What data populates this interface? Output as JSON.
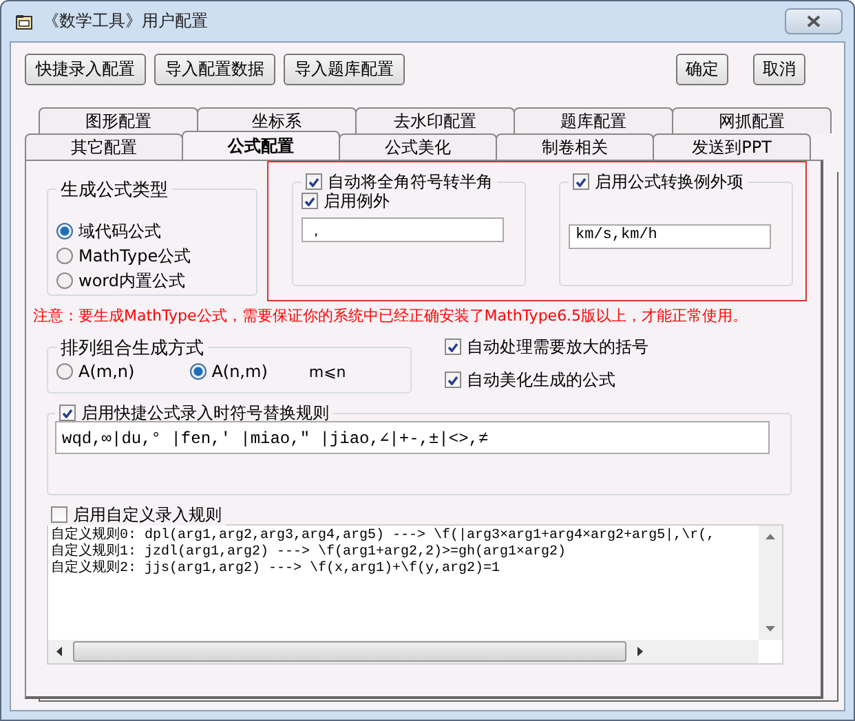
{
  "window": {
    "title": "《数学工具》用户配置"
  },
  "toolbar_buttons": [
    "快捷录入配置",
    "导入配置数据",
    "导入题库配置"
  ],
  "dialog_buttons": [
    "确定",
    "取消"
  ],
  "tabs_back": [
    {
      "label": "图形配置",
      "selected": false
    },
    {
      "label": "坐标系",
      "selected": false
    },
    {
      "label": "去水印配置",
      "selected": false
    },
    {
      "label": "题库配置",
      "selected": false
    },
    {
      "label": "网抓配置",
      "selected": false
    }
  ],
  "tabs_front": [
    {
      "label": "其它配置",
      "selected": false
    },
    {
      "label": "公式配置",
      "selected": true
    },
    {
      "label": "公式美化",
      "selected": false
    },
    {
      "label": "制卷相关",
      "selected": false
    },
    {
      "label": "发送到PPT",
      "selected": false
    }
  ],
  "formula_type": {
    "title": "生成公式类型",
    "options": [
      {
        "label": "域代码公式",
        "selected": true
      },
      {
        "label": "MathType公式",
        "selected": false
      },
      {
        "label": "word内置公式",
        "selected": false
      }
    ]
  },
  "fullwidth": {
    "checkboxes": [
      {
        "label": "自动将全角符号转半角",
        "checked": true
      },
      {
        "label": "启用例外",
        "checked": true
      }
    ],
    "value": "，"
  },
  "exception": {
    "label": "启用公式转换例外项",
    "checked": true,
    "value": "km/s,km/h"
  },
  "notice": "注意：要生成MathType公式，需要保证你的系统中已经正确安装了MathType6.5版以上，才能正常使用。",
  "permutation": {
    "title": "排列组合生成方式",
    "options": [
      {
        "label": "A(m,n)",
        "selected": false
      },
      {
        "label": "A(n,m)",
        "selected": true
      }
    ],
    "note": "m⩽n"
  },
  "auto_options": [
    {
      "label": "自动处理需要放大的括号",
      "checked": true
    },
    {
      "label": "自动美化生成的公式",
      "checked": true
    }
  ],
  "replace_rules": {
    "label": "启用快捷公式录入时符号替换规则",
    "checked": true,
    "value": "wqd,∞|du,° |fen,′ |miao,″ |jiao,∠|+-,±|<>,≠"
  },
  "custom_rules": {
    "label": "启用自定义录入规则",
    "checked": false,
    "lines": [
      "自定义规则0: dpl(arg1,arg2,arg3,arg4,arg5) ---> \\f(|arg3×arg1+arg4×arg2+arg5|,\\r(,",
      "自定义规则1: jzdl(arg1,arg2) ---> \\f(arg1+arg2,2)>=gh(arg1×arg2)",
      "自定义规则2: jjs(arg1,arg2) ---> \\f(x,arg1)+\\f(y,arg2)=1"
    ]
  }
}
